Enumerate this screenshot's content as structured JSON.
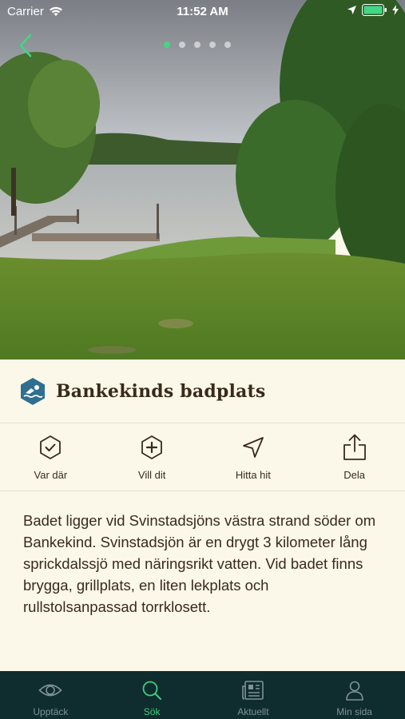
{
  "status_bar": {
    "carrier": "Carrier",
    "time": "11:52 AM"
  },
  "pager": {
    "count": 5,
    "active_index": 0
  },
  "place": {
    "title": "Bankekinds badplats",
    "category_icon": "swimming-icon",
    "description": "Badet ligger vid Svinstadsjöns västra strand söder om Bankekind. Svinstadsjön är en drygt 3 kilometer lång sprickdalssjö med näringsrikt vatten. Vid badet finns brygga, grillplats, en liten lekplats och rullstolsanpassad torrklosett."
  },
  "actions": [
    {
      "label": "Var där",
      "icon": "check-badge-icon"
    },
    {
      "label": "Vill dit",
      "icon": "plus-badge-icon"
    },
    {
      "label": "Hitta hit",
      "icon": "navigation-arrow-icon"
    },
    {
      "label": "Dela",
      "icon": "share-icon"
    }
  ],
  "tabs": [
    {
      "label": "Upptäck",
      "icon": "eye-icon",
      "active": false
    },
    {
      "label": "Sök",
      "icon": "search-icon",
      "active": true
    },
    {
      "label": "Aktuellt",
      "icon": "newspaper-icon",
      "active": false
    },
    {
      "label": "Min sida",
      "icon": "person-icon",
      "active": false
    }
  ],
  "colors": {
    "accent": "#3ecf7d",
    "tabbar_bg": "#0f2c2e",
    "content_bg": "#fbf8ea",
    "text": "#3a2a1a",
    "category_badge": "#2f6f8f"
  }
}
